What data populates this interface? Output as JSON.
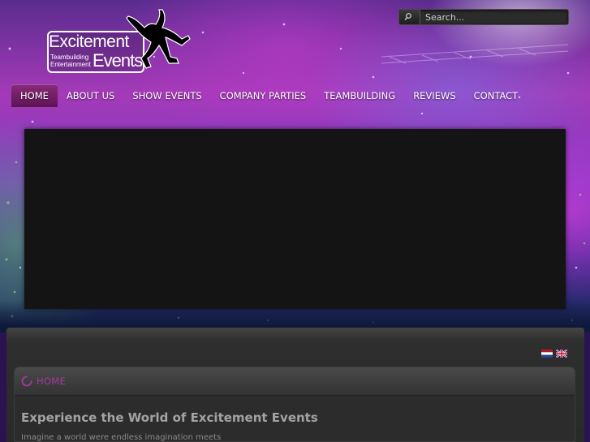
{
  "header": {
    "logo": {
      "title": "Excitement",
      "tagline_1": "Teambuilding",
      "tagline_2": "Entertainment",
      "events": "Events"
    },
    "search": {
      "placeholder": "Search...",
      "icon": "search-icon"
    }
  },
  "nav": {
    "items": [
      {
        "label": "HOME",
        "active": true
      },
      {
        "label": "ABOUT US",
        "active": false
      },
      {
        "label": "SHOW EVENTS",
        "active": false
      },
      {
        "label": "COMPANY PARTIES",
        "active": false
      },
      {
        "label": "TEAMBUILDING",
        "active": false
      },
      {
        "label": "REVIEWS",
        "active": false
      },
      {
        "label": "CONTACT",
        "active": false
      }
    ],
    "active_color": "#7a2070"
  },
  "languages": [
    "dutch-flag-icon",
    "uk-flag-icon"
  ],
  "content": {
    "box_title": "HOME",
    "heading": "Experience the World of Excitement Events",
    "paragraph": "Imagine a world were endless imagination meets"
  },
  "colors": {
    "accent": "#a43aa0",
    "content_bg": "#2a2a2a",
    "slider_bg": "#141414"
  }
}
